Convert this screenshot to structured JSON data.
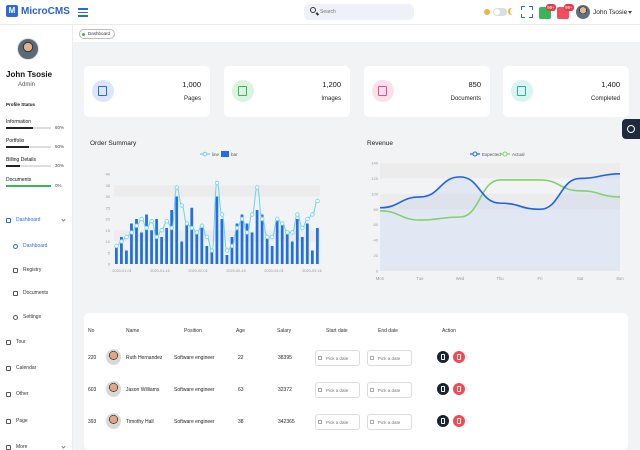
{
  "app": {
    "name": "MicroCMS"
  },
  "header": {
    "search_placeholder": "Search",
    "messages_count": "99+",
    "notifications_count": "99+",
    "user_name": "John Tsosie"
  },
  "profile": {
    "name": "John Tsosie",
    "role": "Admin",
    "status_title": "Profile Status",
    "bars": [
      {
        "label": "Information",
        "percent": "60%",
        "value": 0.6,
        "color": "#222222"
      },
      {
        "label": "Portfolio",
        "percent": "50%",
        "value": 0.5,
        "color": "#222222"
      },
      {
        "label": "Billing Details",
        "percent": "30%",
        "value": 0.3,
        "color": "#222222"
      },
      {
        "label": "Documents",
        "percent": "0%",
        "value": 1.0,
        "color": "#3bb55a"
      }
    ]
  },
  "nav": {
    "dashboard": "Dashboard",
    "sub_dashboard": "Dashboard",
    "registry": "Registry",
    "documents": "Documents",
    "settings": "Settings",
    "tour": "Tour",
    "calendar": "Calendar",
    "other": "Other",
    "page": "Page",
    "more": "More"
  },
  "breadcrumb": "Dashboard",
  "cards": [
    {
      "value": "1,000",
      "label": "Pages",
      "icon": "file-icon",
      "bg": "#dbe6fb",
      "fg": "#2a6bdc"
    },
    {
      "value": "1,200",
      "label": "Images",
      "icon": "image-icon",
      "bg": "#dcf3e0",
      "fg": "#3bb55a"
    },
    {
      "value": "850",
      "label": "Documents",
      "icon": "document-icon",
      "bg": "#fde0ec",
      "fg": "#e0528a"
    },
    {
      "value": "1,400",
      "label": "Completed",
      "icon": "grid-icon",
      "bg": "#d9f4f1",
      "fg": "#27b3a3"
    }
  ],
  "order_summary": {
    "title": "Order Summary",
    "legend": [
      "line",
      "bar"
    ],
    "y_ticks": [
      "40",
      "35",
      "30",
      "25",
      "20",
      "15",
      "10",
      "5",
      "0"
    ],
    "x_ticks": [
      "2020-01-01",
      "2020-01-16",
      "2020-02-01",
      "2020-02-16",
      "2020-03-01",
      "2020-03-16"
    ],
    "chart_data": {
      "type": "bar",
      "ylim": [
        0,
        40
      ],
      "bars": [
        8,
        12,
        6,
        18,
        20,
        14,
        22,
        15,
        20,
        12,
        16,
        24,
        30,
        10,
        18,
        25,
        14,
        16,
        8,
        6,
        30,
        20,
        4,
        12,
        18,
        22,
        18,
        14,
        24,
        22,
        12,
        8,
        20,
        18,
        14,
        10,
        20,
        12,
        18,
        6,
        16
      ],
      "line": [
        8,
        10,
        12,
        14,
        17,
        20,
        16,
        19,
        12,
        15,
        19,
        16,
        34,
        26,
        18,
        16,
        14,
        17,
        12,
        6,
        36,
        22,
        6,
        8,
        16,
        20,
        14,
        22,
        34,
        20,
        12,
        12,
        20,
        18,
        14,
        14,
        22,
        16,
        20,
        22,
        28
      ]
    }
  },
  "revenue": {
    "title": "Revenue",
    "legend": [
      "Expected",
      "Actual"
    ],
    "y_ticks": [
      "140",
      "120",
      "100",
      "80",
      "60",
      "40",
      "20",
      "0"
    ],
    "x_ticks": [
      "Mon",
      "Tue",
      "Wed",
      "Thu",
      "Fri",
      "Sat",
      "Sun"
    ],
    "chart_data": {
      "type": "line",
      "categories": [
        "Mon",
        "Tue",
        "Wed",
        "Thu",
        "Fri",
        "Sat",
        "Sun"
      ],
      "ylim": [
        0,
        140
      ],
      "series": [
        {
          "name": "Expected",
          "color": "#1e62e6",
          "values": [
            82,
            96,
            122,
            88,
            80,
            120,
            126
          ]
        },
        {
          "name": "Actual",
          "color": "#84d06a",
          "values": [
            78,
            66,
            70,
            118,
            118,
            104,
            96
          ]
        }
      ]
    }
  },
  "table": {
    "headers": [
      "No",
      "Name",
      "Position",
      "Age",
      "Salary",
      "Start date",
      "End date",
      "Action"
    ],
    "date_placeholder": "Pick a date",
    "rows": [
      {
        "no": "220",
        "name": "Ruth Hernandez",
        "position": "Software engineer",
        "age": "22",
        "salary": "38395"
      },
      {
        "no": "603",
        "name": "Jason Williams",
        "position": "Software engineer",
        "age": "63",
        "salary": "32372"
      },
      {
        "no": "393",
        "name": "Timothy Hall",
        "position": "Software engineer",
        "age": "38",
        "salary": "342365"
      }
    ]
  }
}
